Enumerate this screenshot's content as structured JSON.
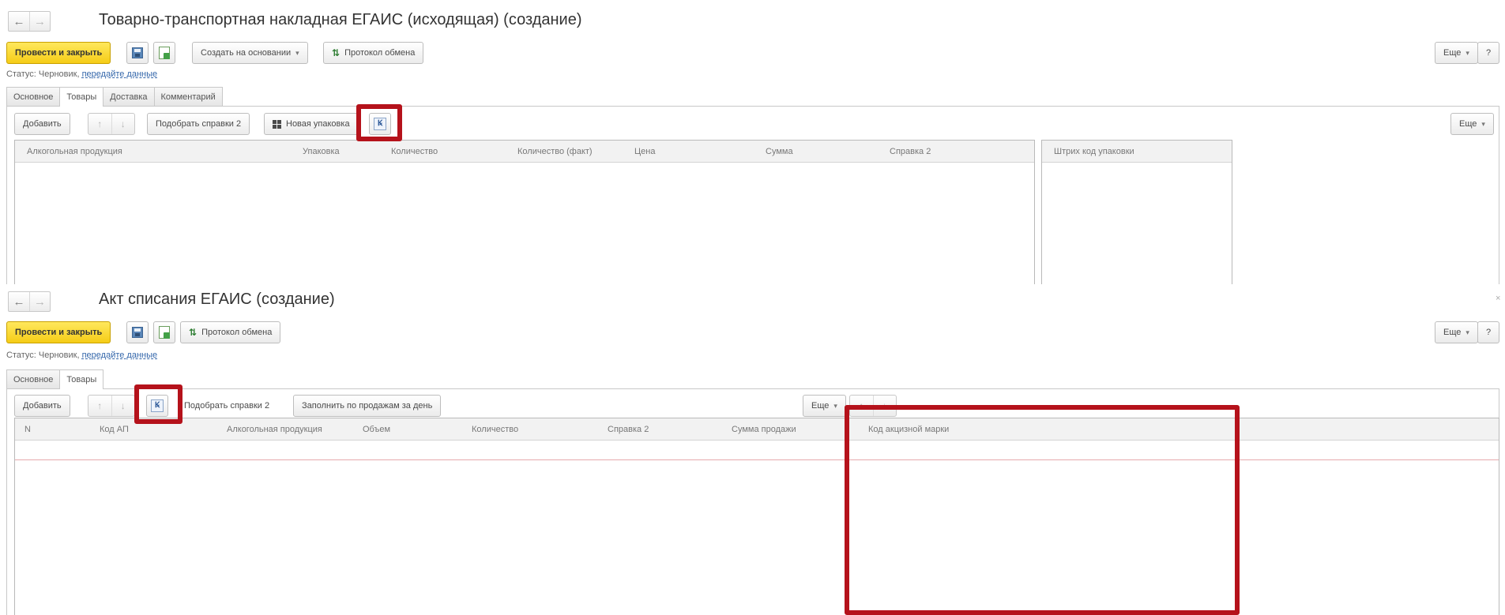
{
  "form1": {
    "title": "Товарно-транспортная накладная ЕГАИС (исходящая) (создание)",
    "toolbar": {
      "post_close": "Провести и закрыть",
      "create_based": "Создать на основании",
      "exchange_log": "Протокол обмена",
      "more": "Еще",
      "help": "?"
    },
    "status": {
      "label": "Статус:",
      "value": "Черновик,",
      "link": "передайте данные"
    },
    "tabs": [
      "Основное",
      "Товары",
      "Доставка",
      "Комментарий"
    ],
    "goods_toolbar": {
      "add": "Добавить",
      "pick_certs": "Подобрать справки 2",
      "new_package": "Новая упаковка",
      "more": "Еще"
    },
    "columns": [
      "Алкогольная продукция",
      "Упаковка",
      "Количество",
      "Количество (факт)",
      "Цена",
      "Сумма",
      "Справка 2"
    ],
    "side_column": "Штрих код упаковки"
  },
  "form2": {
    "title": "Акт списания ЕГАИС (создание)",
    "toolbar": {
      "post_close": "Провести и закрыть",
      "exchange_log": "Протокол обмена",
      "more": "Еще",
      "help": "?"
    },
    "status": {
      "label": "Статус:",
      "value": "Черновик,",
      "link": "передайте данные"
    },
    "tabs": [
      "Основное",
      "Товары"
    ],
    "goods_toolbar": {
      "add": "Добавить",
      "pick_certs": "Подобрать справки 2",
      "fill_by_sales": "Заполнить по продажам за день",
      "more": "Еще"
    },
    "columns": [
      "N",
      "Код АП",
      "Алкогольная продукция",
      "Объем",
      "Количество",
      "Справка 2",
      "Сумма продажи"
    ],
    "side_column": "Код акцизной марки"
  },
  "colors": {
    "highlight": "#b5121b",
    "primary": "#f5cc17",
    "link": "#3366aa"
  },
  "icons": [
    "back-arrow-icon",
    "forward-arrow-icon",
    "save-icon",
    "document-icon",
    "exchange-icon",
    "package-icon",
    "pick-mark-icon"
  ]
}
